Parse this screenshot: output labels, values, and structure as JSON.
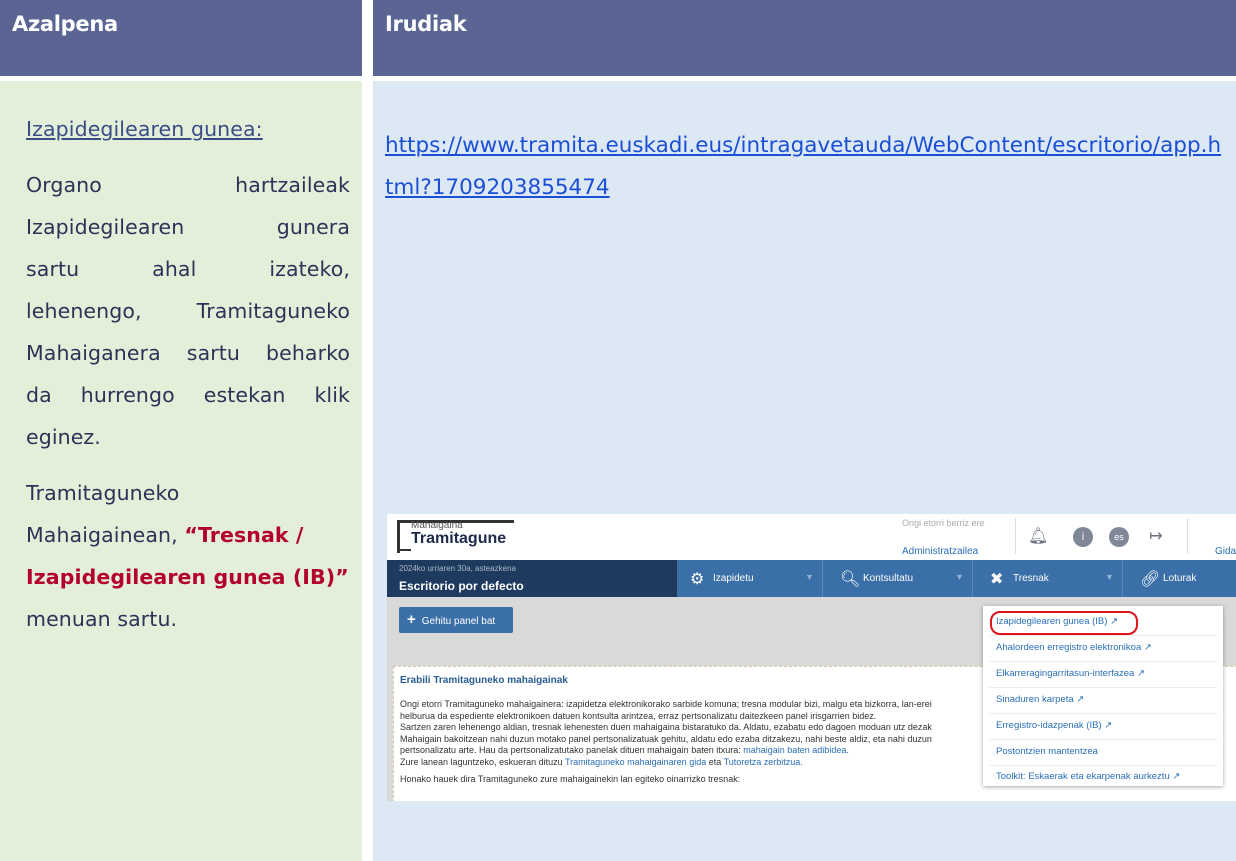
{
  "headers": {
    "left": "Azalpena",
    "right": "Irudiak"
  },
  "left": {
    "title": "Izapidegilearen gunea:",
    "p1_lines": [
      "Organo hartzaileak",
      "Izapidegilearen gunera",
      "sartu ahal izateko,",
      "lehenengo, Tramitaguneko",
      "Mahaiganera sartu beharko",
      "da hurrengo estekan klik"
    ],
    "p1_last": "eginez.",
    "p2_a1": "Tramitaguneko",
    "p2_a2": "Mahaigainean,",
    "p2_bold1": "“Tresnak /",
    "p2_bold2": "Izapidegilearen gunea (IB)”",
    "p2_end": "menuan sartu."
  },
  "right": {
    "url": "https://www.tramita.euskadi.eus/intragavetauda/WebContent/escritorio/app.html?1709203855474"
  },
  "screenshot": {
    "logo_small": "Mahaigaina",
    "logo_big": "Tramitagune",
    "welcome": "Ongi etorri berriz ere",
    "admin": "Administratzailea",
    "help": "Gidali",
    "lang_badge": "es",
    "date": "2024ko urriaren 30a, asteazkena",
    "desk_name": "Escritorio por defecto",
    "nav": [
      "Izapidetu",
      "Kontsultatu",
      "Tresnak",
      "Loturak"
    ],
    "add_panel": "Gehitu panel bat",
    "panel_title": "Erabili Tramitaguneko mahaigainak",
    "panel_lines": [
      "Ongi etorri Tramitaguneko mahaigainera: izapidetza elektronikorako sarbide komuna; tresna modular bizi, malgu eta bizkorra, lan-erei",
      "helburua da espediente elektronikoen datuen kontsulta arintzea, erraz pertsonalizatu daitezkeen panel irisgarrien bidez.",
      "Sartzen zaren lehenengo aldian, tresnak lehenesten duen mahaigaina bistaratuko da. Aldatu, ezabatu edo dagoen moduan utz dezak",
      "Mahaigain bakoitzean nahi duzun motako panel pertsonalizatuak gehitu, aldatu edo ezaba ditzakezu, nahi beste aldiz, eta nahi duzun",
      "pertsonalizatu arte. Hau da pertsonalizatutako panelak dituen mahaigain baten itxura:"
    ],
    "panel_link1": "mahaigain baten adibidea.",
    "panel_line6_a": "Zure lanean laguntzeko, eskueran dituzu",
    "panel_link2": "Tramitaguneko mahaigainaren gida",
    "panel_line6_b": "eta",
    "panel_link3": "Tutoretza zerbitzua.",
    "panel_line7": "Honako hauek dira Tramitaguneko zure mahaigainekin lan egiteko oinarrizko tresnak:",
    "menu": [
      "Izapidegilearen gunea (IB) ↗",
      "Ahalordeen erregistro elektronikoa ↗",
      "Elkarreragingarritasun-interfazea ↗",
      "Sinaduren karpeta ↗",
      "Erregistro-idazpenak (IB) ↗",
      "Postontzien mantentzea",
      "Toolkit: Eskaerak eta ekarpenak aurkeztu ↗"
    ],
    "colors": {
      "nav": "#3a6fa8",
      "nav_dark": "#1e3a5f",
      "highlight": "#e0121a"
    }
  }
}
